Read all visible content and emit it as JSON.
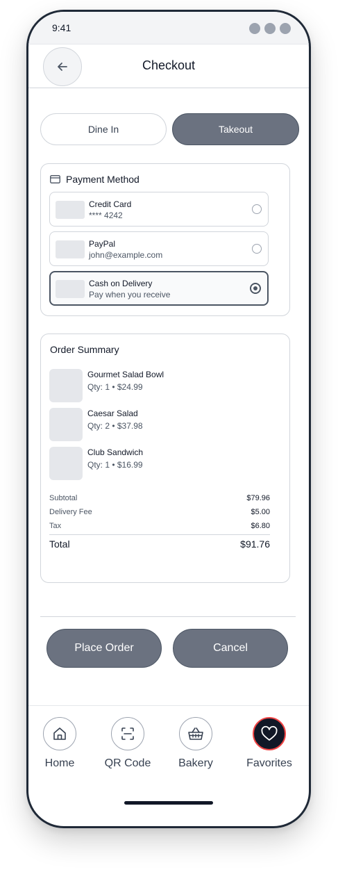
{
  "status_bar": {
    "time": "9:41"
  },
  "header": {
    "title": "Checkout"
  },
  "order_type": {
    "options": [
      "Dine In",
      "Takeout"
    ],
    "selected": "Takeout"
  },
  "payment": {
    "title": "Payment Method",
    "options": [
      {
        "name": "Credit Card",
        "detail": "**** 4242",
        "selected": false
      },
      {
        "name": "PayPal",
        "detail": "john@example.com",
        "selected": false
      },
      {
        "name": "Cash on Delivery",
        "detail": "Pay when you receive",
        "selected": true
      }
    ]
  },
  "summary": {
    "title": "Order Summary",
    "items": [
      {
        "name": "Gourmet Salad Bowl",
        "detail": "Qty: 1 • $24.99"
      },
      {
        "name": "Caesar Salad",
        "detail": "Qty: 2 • $37.98"
      },
      {
        "name": "Club Sandwich",
        "detail": "Qty: 1 • $16.99"
      }
    ],
    "subtotal_label": "Subtotal",
    "subtotal": "$79.96",
    "delivery_label": "Delivery Fee",
    "delivery": "$5.00",
    "tax_label": "Tax",
    "tax": "$6.80",
    "total_label": "Total",
    "total": "$91.76"
  },
  "actions": {
    "place_order": "Place Order",
    "cancel": "Cancel"
  },
  "bottom_nav": {
    "items": [
      {
        "label": "Home",
        "icon": "home-icon"
      },
      {
        "label": "QR Code",
        "icon": "qr-scan-icon"
      },
      {
        "label": "Bakery",
        "icon": "basket-icon"
      },
      {
        "label": "Favorites",
        "icon": "heart-icon",
        "active": true
      }
    ]
  },
  "colors": {
    "accent": "#6b7280",
    "active_nav": "#111827",
    "active_ring": "#ef4444"
  }
}
